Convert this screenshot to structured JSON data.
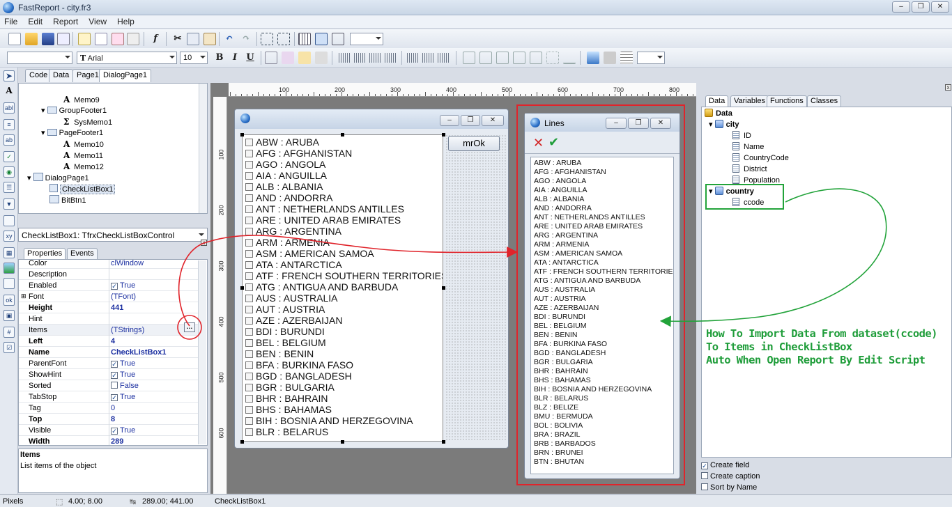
{
  "window": {
    "title": "FastReport - city.fr3"
  },
  "menu": [
    "File",
    "Edit",
    "Report",
    "View",
    "Help"
  ],
  "format_toolbar": {
    "font_name": "Arial",
    "font_size": "10",
    "bold": "B",
    "italic": "I",
    "underline": "U"
  },
  "designer_tabs": [
    "Code",
    "Data",
    "Page1",
    "DialogPage1"
  ],
  "report_tree": [
    {
      "label": "Memo9",
      "kind": "memo"
    },
    {
      "label": "GroupFooter1",
      "kind": "band"
    },
    {
      "label": "SysMemo1",
      "kind": "sysmemo"
    },
    {
      "label": "PageFooter1",
      "kind": "band"
    },
    {
      "label": "Memo10",
      "kind": "memo"
    },
    {
      "label": "Memo11",
      "kind": "memo"
    },
    {
      "label": "Memo12",
      "kind": "memo"
    },
    {
      "label": "DialogPage1",
      "kind": "page"
    },
    {
      "label": "CheckListBox1",
      "kind": "checklistbox"
    },
    {
      "label": "BitBtn1",
      "kind": "bitbtn"
    }
  ],
  "object_selector": "CheckListBox1: TfrxCheckListBoxControl",
  "inspector_tabs": [
    "Properties",
    "Events"
  ],
  "properties": [
    {
      "name": "Color",
      "value": "clWindow",
      "bold": false,
      "check": "none"
    },
    {
      "name": "Description",
      "value": "",
      "bold": false,
      "check": "none"
    },
    {
      "name": "Enabled",
      "value": "True",
      "bold": false,
      "check": "on"
    },
    {
      "name": "Font",
      "value": "(TFont)",
      "bold": false,
      "check": "none"
    },
    {
      "name": "Height",
      "value": "441",
      "bold": true,
      "check": "none"
    },
    {
      "name": "Hint",
      "value": "",
      "bold": false,
      "check": "none"
    },
    {
      "name": "Items",
      "value": "(TStrings)",
      "bold": false,
      "check": "none"
    },
    {
      "name": "Left",
      "value": "4",
      "bold": true,
      "check": "none"
    },
    {
      "name": "Name",
      "value": "CheckListBox1",
      "bold": true,
      "check": "none"
    },
    {
      "name": "ParentFont",
      "value": "True",
      "bold": false,
      "check": "on"
    },
    {
      "name": "ShowHint",
      "value": "True",
      "bold": false,
      "check": "on"
    },
    {
      "name": "Sorted",
      "value": "False",
      "bold": false,
      "check": "off"
    },
    {
      "name": "TabStop",
      "value": "True",
      "bold": false,
      "check": "on"
    },
    {
      "name": "Tag",
      "value": "0",
      "bold": false,
      "check": "none"
    },
    {
      "name": "Top",
      "value": "8",
      "bold": true,
      "check": "none"
    },
    {
      "name": "Visible",
      "value": "True",
      "bold": false,
      "check": "on"
    },
    {
      "name": "Width",
      "value": "289",
      "bold": true,
      "check": "none"
    }
  ],
  "description": {
    "title": "Items",
    "text": "List items of the object"
  },
  "rulers": {
    "horizontal": [
      "100",
      "200",
      "300",
      "400",
      "500",
      "600",
      "700",
      "800"
    ],
    "vertical": [
      "100",
      "200",
      "300",
      "400",
      "500",
      "600"
    ]
  },
  "dialog": {
    "button_label": "mrOk"
  },
  "checklist_items": [
    "ABW : ARUBA",
    "AFG : AFGHANISTAN",
    "AGO : ANGOLA",
    "AIA : ANGUILLA",
    "ALB : ALBANIA",
    "AND : ANDORRA",
    "ANT : NETHERLANDS ANTILLES",
    "ARE : UNITED ARAB EMIRATES",
    "ARG : ARGENTINA",
    "ARM : ARMENIA",
    "ASM : AMERICAN SAMOA",
    "ATA : ANTARCTICA",
    "ATF : FRENCH SOUTHERN TERRITORIES",
    "ATG : ANTIGUA AND BARBUDA",
    "AUS : AUSTRALIA",
    "AUT : AUSTRIA",
    "AZE : AZERBAIJAN",
    "BDI : BURUNDI",
    "BEL : BELGIUM",
    "BEN : BENIN",
    "BFA : BURKINA FASO",
    "BGD : BANGLADESH",
    "BGR : BULGARIA",
    "BHR : BAHRAIN",
    "BHS : BAHAMAS",
    "BIH : BOSNIA AND HERZEGOVINA",
    "BLR : BELARUS"
  ],
  "lines_editor": {
    "title": "Lines",
    "items": [
      "ABW : ARUBA",
      "AFG : AFGHANISTAN",
      "AGO : ANGOLA",
      "AIA : ANGUILLA",
      "ALB : ALBANIA",
      "AND : ANDORRA",
      "ANT : NETHERLANDS ANTILLES",
      "ARE : UNITED ARAB EMIRATES",
      "ARG : ARGENTINA",
      "ARM : ARMENIA",
      "ASM : AMERICAN SAMOA",
      "ATA : ANTARCTICA",
      "ATF : FRENCH SOUTHERN TERRITORIES",
      "ATG : ANTIGUA AND BARBUDA",
      "AUS : AUSTRALIA",
      "AUT : AUSTRIA",
      "AZE : AZERBAIJAN",
      "BDI : BURUNDI",
      "BEL : BELGIUM",
      "BEN : BENIN",
      "BFA : BURKINA FASO",
      "BGD : BANGLADESH",
      "BGR : BULGARIA",
      "BHR : BAHRAIN",
      "BHS : BAHAMAS",
      "BIH : BOSNIA AND HERZEGOVINA",
      "BLR : BELARUS",
      "BLZ : BELIZE",
      "BMU : BERMUDA",
      "BOL : BOLIVIA",
      "BRA : BRAZIL",
      "BRB : BARBADOS",
      "BRN : BRUNEI",
      "BTN : BHUTAN"
    ]
  },
  "data_tabs": [
    "Data",
    "Variables",
    "Functions",
    "Classes"
  ],
  "data_tree": {
    "root": "Data",
    "datasets": [
      {
        "name": "city",
        "fields": [
          "ID",
          "Name",
          "CountryCode",
          "District",
          "Population"
        ]
      },
      {
        "name": "country",
        "fields": [
          "ccode"
        ]
      }
    ]
  },
  "annotation": [
    "How To Import Data From dataset(ccode)",
    "To Items in CheckListBox",
    "Auto When Open Report By Edit Script"
  ],
  "options": [
    {
      "label": "Create field",
      "checked": true
    },
    {
      "label": "Create caption",
      "checked": false
    },
    {
      "label": "Sort by Name",
      "checked": false
    }
  ],
  "status": {
    "units": "Pixels",
    "position": "4.00; 8.00",
    "size": "289.00; 441.00",
    "object": "CheckListBox1"
  },
  "colors": {
    "red_annotation": "#e0242b",
    "green_annotation": "#1f9d3a"
  }
}
